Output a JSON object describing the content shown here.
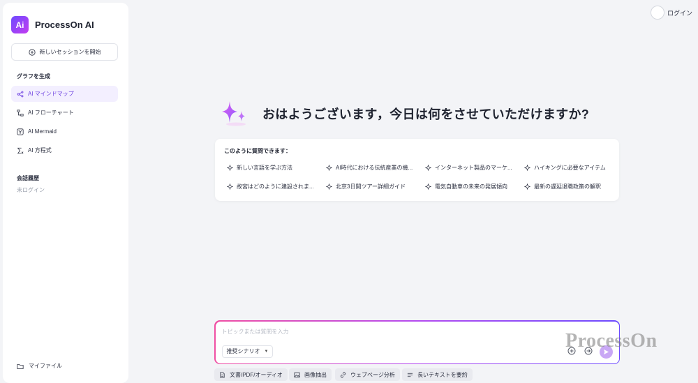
{
  "app": {
    "logo_mark": "Ai",
    "name": "ProcessOn AI"
  },
  "sidebar": {
    "new_session_label": "新しいセッションを開始",
    "generate_title": "グラフを生成",
    "items": [
      {
        "label": "AI マインドマップ",
        "icon": "mindmap-icon",
        "active": true
      },
      {
        "label": "AI フローチャート",
        "icon": "flowchart-icon",
        "active": false
      },
      {
        "label": "AI Mermaid",
        "icon": "mermaid-icon",
        "active": false
      },
      {
        "label": "AI 方程式",
        "icon": "formula-icon",
        "active": false
      }
    ],
    "history_title": "会話履歴",
    "history_status": "未ログイン",
    "my_files_label": "マイファイル"
  },
  "header": {
    "login_label": "ログイン"
  },
  "main": {
    "greeting": "おはようございます，今日は何をさせていただけますか?",
    "suggestions_title": "このように質問できます：",
    "suggestions": [
      "新しい言語を学ぶ方法",
      "AI時代における伝統産業の機...",
      "インターネット製品のマーケ...",
      "ハイキングに必要なアイテム",
      "故宮はどのように建設されま...",
      "北京3日間ツアー詳細ガイド",
      "電気自動車の未来の発展傾向",
      "最新の遅延退職政策の解釈"
    ]
  },
  "input": {
    "placeholder": "トピックまたは質問を入力",
    "scenario_label": "推奨シナリオ",
    "watermark": "ProcessOn"
  },
  "chips": [
    {
      "label": "文書/PDF/オーディオ",
      "icon": "document-icon"
    },
    {
      "label": "画像抽出",
      "icon": "image-icon"
    },
    {
      "label": "ウェブページ分析",
      "icon": "link-icon"
    },
    {
      "label": "長いテキストを要約",
      "icon": "text-lines-icon"
    }
  ],
  "colors": {
    "accent": "#6b3fe0",
    "active_bg": "#f3efff",
    "send": "#c9a8f5"
  }
}
